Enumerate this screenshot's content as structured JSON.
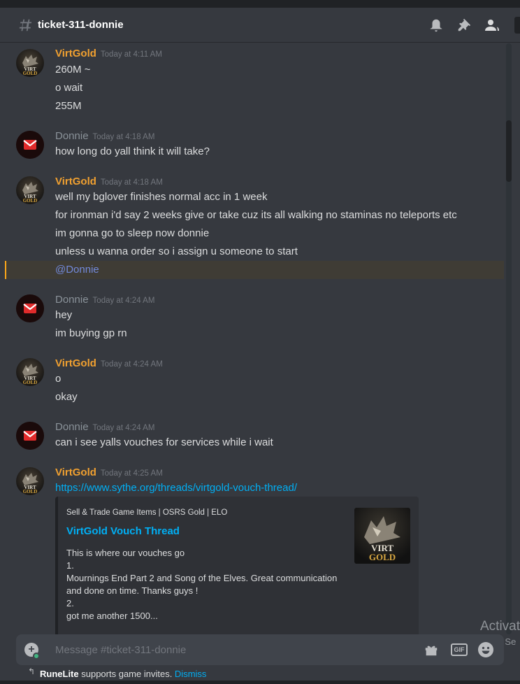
{
  "header": {
    "channel_name": "ticket-311-donnie"
  },
  "messages": [
    {
      "author": "VirtGold",
      "timestamp": "Today at 4:11 AM",
      "lines": [
        "260M ~",
        "o wait",
        "255M"
      ]
    },
    {
      "author": "Donnie",
      "timestamp": "Today at 4:18 AM",
      "lines": [
        "how long do yall think it will take?"
      ]
    },
    {
      "author": "VirtGold",
      "timestamp": "Today at 4:18 AM",
      "lines": [
        "well my bglover finishes normal acc in 1 week",
        "for ironman i'd say 2 weeks give or take cuz its all walking no staminas no teleports etc",
        "im gonna go to sleep now donnie",
        "unless u wanna order so i assign u someone to start"
      ],
      "mention": "@Donnie"
    },
    {
      "author": "Donnie",
      "timestamp": "Today at 4:24 AM",
      "lines": [
        "hey",
        "im buying gp rn"
      ]
    },
    {
      "author": "VirtGold",
      "timestamp": "Today at 4:24 AM",
      "lines": [
        "o",
        "okay"
      ]
    },
    {
      "author": "Donnie",
      "timestamp": "Today at 4:24 AM",
      "lines": [
        "can i see yalls vouches for services while i wait"
      ]
    },
    {
      "author": "VirtGold",
      "timestamp": "Today at 4:25 AM",
      "link": "https://www.sythe.org/threads/virtgold-vouch-thread/"
    }
  ],
  "embed": {
    "provider": "Sell & Trade Game Items | OSRS Gold | ELO",
    "title": "VirtGold Vouch Thread",
    "description": "This is where our vouches go\n1.\nMournings End Part 2 and Song of the Elves. Great communication and done on time. Thanks guys !\n2.\ngot me another 1500...",
    "thumb_line1": "VIRT",
    "thumb_line2": "GOLD"
  },
  "avatar_text": {
    "line1": "VIRT",
    "line2": "GOLD"
  },
  "composer": {
    "placeholder": "Message #ticket-311-donnie",
    "gif_label": "GIF"
  },
  "invite_bar": {
    "brand": "RuneLite",
    "text": " supports game invites. ",
    "dismiss": "Dismiss"
  },
  "watermark": {
    "line1": "Activat",
    "line2": "Go to Se"
  },
  "colors": {
    "background": "#36393f",
    "virtgold_name": "#f0a030",
    "donnie_name": "#8a9299",
    "link": "#00aff4",
    "mention": "#7289da"
  },
  "icons": [
    "hashtag-icon",
    "bell-icon",
    "pin-icon",
    "members-icon",
    "gift-icon",
    "gif-icon",
    "emoji-icon",
    "add-attachment-icon"
  ]
}
